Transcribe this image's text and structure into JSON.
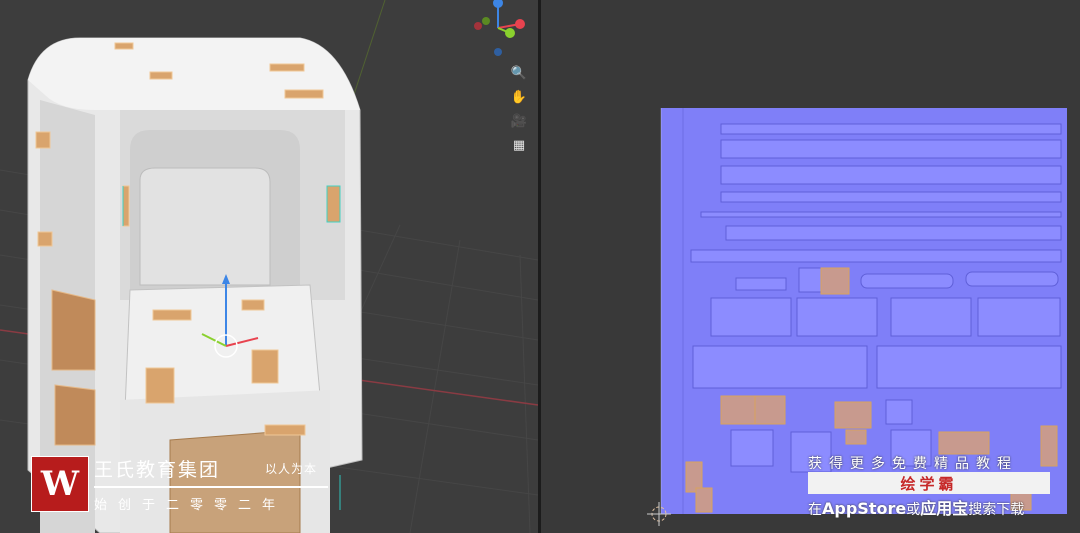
{
  "viewport": {
    "gizmo_axes": [
      "x-axis",
      "y-axis",
      "z-axis"
    ],
    "nav_tools": [
      {
        "name": "zoom-icon",
        "glyph": "🔍"
      },
      {
        "name": "pan-hand-icon",
        "glyph": "✋"
      },
      {
        "name": "camera-icon",
        "glyph": "🎥"
      },
      {
        "name": "perspective-grid-icon",
        "glyph": "▦"
      }
    ]
  },
  "watermark": {
    "logo_letter": "W",
    "title": "王氏教育集团",
    "motto": "以人为本",
    "subtitle": "始创于二零零二年"
  },
  "advert": {
    "line1": "获得更多免费精品教程",
    "brand": "绘学霸",
    "line3_prefix": "在",
    "line3_store": "AppStore",
    "line3_mid": "或",
    "line3_app": "应用宝",
    "line3_suffix": "搜索下载"
  },
  "colors": {
    "viewport_bg": "#3d3d3d",
    "uv_bg": "#393939",
    "normal_map": "#7f7ff8",
    "axis_x": "#e8434f",
    "axis_y": "#8ad12e",
    "axis_z": "#3d86e6",
    "brand_red": "#c62828"
  }
}
